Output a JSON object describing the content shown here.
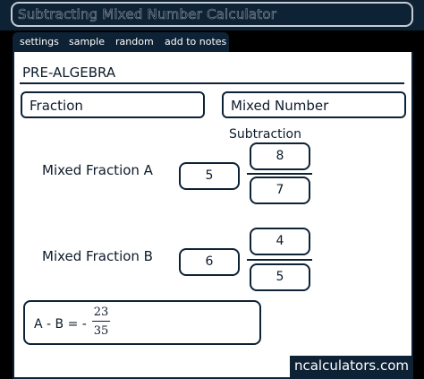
{
  "window": {
    "title": "Subtracting Mixed Number Calculator"
  },
  "tabs": [
    {
      "label": "settings"
    },
    {
      "label": "sample"
    },
    {
      "label": "random"
    },
    {
      "label": "add to notes"
    }
  ],
  "section": {
    "label": "PRE-ALGEBRA"
  },
  "modes": {
    "fraction_label": "Fraction",
    "mixed_label": "Mixed Number"
  },
  "operation": {
    "label": "Subtraction"
  },
  "fraction_a": {
    "label": "Mixed Fraction A",
    "whole": "5",
    "numerator": "8",
    "denominator": "7"
  },
  "fraction_b": {
    "label": "Mixed Fraction B",
    "whole": "6",
    "numerator": "4",
    "denominator": "5"
  },
  "result": {
    "expression": "A - B  =  -",
    "numerator": "23",
    "denominator": "35"
  },
  "brand": {
    "label": "ncalculators.com"
  },
  "colors": {
    "dark": "#0e2236",
    "panel": "#ffffff"
  }
}
